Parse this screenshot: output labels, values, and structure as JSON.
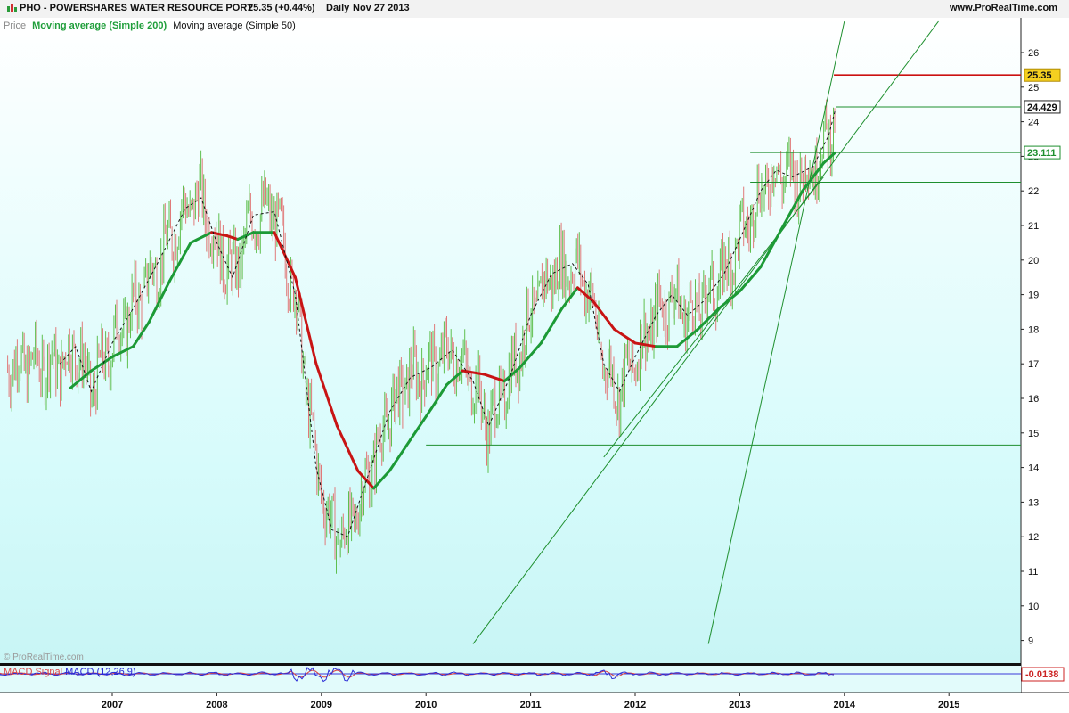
{
  "header": {
    "symbol_label": "PHO - POWERSHARES WATER RESOURCE PORT",
    "quote": "25.35 (+0.44%)",
    "period": "Daily",
    "date": "Nov 27 2013",
    "site": "www.ProRealTime.com"
  },
  "legend": {
    "price": "Price",
    "ma200": "Moving average (Simple 200)",
    "ma50": "Moving average (Simple 50)"
  },
  "watermark": "© ProRealTime.com",
  "macd_legend": {
    "part1": "MACD",
    "part2": " ",
    "part3": "Signal",
    "part4": " MACD (12,26,9)"
  },
  "colors": {
    "plot_bg": "#d6fbfb",
    "candle_up": "#5fbf4f",
    "candle_down": "#e07a7a",
    "ma200_up": "#1c9a36",
    "ma200_down": "#c81414",
    "ma50": "#111111",
    "trend": "#1e8f2e",
    "resistance": "#cc1111",
    "last_price_box": "#f5d020",
    "macd": "#2b2bd6",
    "signal": "#d33"
  },
  "chart_data": {
    "type": "candlestick",
    "y_axis": {
      "range": [
        8.4,
        26.9
      ],
      "ticks": [
        9,
        10,
        11,
        12,
        13,
        14,
        15,
        16,
        17,
        18,
        19,
        20,
        21,
        22,
        23,
        24,
        25,
        26
      ]
    },
    "x_axis": {
      "ticks": [
        "2007",
        "2008",
        "2009",
        "2010",
        "2011",
        "2012",
        "2013",
        "2014",
        "2015"
      ]
    },
    "ma200": [
      {
        "t": 2006.6,
        "v": 16.3
      },
      {
        "t": 2006.8,
        "v": 16.8
      },
      {
        "t": 2007.0,
        "v": 17.2
      },
      {
        "t": 2007.2,
        "v": 17.5
      },
      {
        "t": 2007.35,
        "v": 18.2
      },
      {
        "t": 2007.55,
        "v": 19.4
      },
      {
        "t": 2007.75,
        "v": 20.5
      },
      {
        "t": 2007.95,
        "v": 20.8
      },
      {
        "t": 2008.1,
        "v": 20.7
      },
      {
        "t": 2008.2,
        "v": 20.6
      },
      {
        "t": 2008.35,
        "v": 20.8
      },
      {
        "t": 2008.55,
        "v": 20.8
      },
      {
        "t": 2008.75,
        "v": 19.5
      },
      {
        "t": 2008.95,
        "v": 17.0
      },
      {
        "t": 2009.15,
        "v": 15.2
      },
      {
        "t": 2009.35,
        "v": 13.9
      },
      {
        "t": 2009.5,
        "v": 13.4
      },
      {
        "t": 2009.65,
        "v": 13.9
      },
      {
        "t": 2009.85,
        "v": 14.8
      },
      {
        "t": 2010.05,
        "v": 15.7
      },
      {
        "t": 2010.2,
        "v": 16.4
      },
      {
        "t": 2010.35,
        "v": 16.8
      },
      {
        "t": 2010.55,
        "v": 16.7
      },
      {
        "t": 2010.75,
        "v": 16.5
      },
      {
        "t": 2010.9,
        "v": 16.9
      },
      {
        "t": 2011.1,
        "v": 17.6
      },
      {
        "t": 2011.3,
        "v": 18.6
      },
      {
        "t": 2011.45,
        "v": 19.2
      },
      {
        "t": 2011.6,
        "v": 18.8
      },
      {
        "t": 2011.8,
        "v": 18.0
      },
      {
        "t": 2012.0,
        "v": 17.6
      },
      {
        "t": 2012.2,
        "v": 17.5
      },
      {
        "t": 2012.4,
        "v": 17.5
      },
      {
        "t": 2012.6,
        "v": 18.0
      },
      {
        "t": 2012.8,
        "v": 18.6
      },
      {
        "t": 2013.0,
        "v": 19.1
      },
      {
        "t": 2013.2,
        "v": 19.8
      },
      {
        "t": 2013.4,
        "v": 20.9
      },
      {
        "t": 2013.6,
        "v": 22.0
      },
      {
        "t": 2013.8,
        "v": 22.8
      },
      {
        "t": 2013.91,
        "v": 23.1
      }
    ],
    "ma50": [
      {
        "t": 2006.5,
        "v": 17.0
      },
      {
        "t": 2006.65,
        "v": 17.5
      },
      {
        "t": 2006.8,
        "v": 16.2
      },
      {
        "t": 2007.0,
        "v": 17.6
      },
      {
        "t": 2007.2,
        "v": 18.6
      },
      {
        "t": 2007.45,
        "v": 20.0
      },
      {
        "t": 2007.7,
        "v": 21.5
      },
      {
        "t": 2007.85,
        "v": 21.8
      },
      {
        "t": 2008.0,
        "v": 20.5
      },
      {
        "t": 2008.15,
        "v": 19.5
      },
      {
        "t": 2008.35,
        "v": 21.3
      },
      {
        "t": 2008.55,
        "v": 21.4
      },
      {
        "t": 2008.75,
        "v": 19.0
      },
      {
        "t": 2008.95,
        "v": 14.0
      },
      {
        "t": 2009.1,
        "v": 12.2
      },
      {
        "t": 2009.25,
        "v": 12.0
      },
      {
        "t": 2009.45,
        "v": 13.8
      },
      {
        "t": 2009.65,
        "v": 15.6
      },
      {
        "t": 2009.85,
        "v": 16.6
      },
      {
        "t": 2010.05,
        "v": 16.9
      },
      {
        "t": 2010.25,
        "v": 17.4
      },
      {
        "t": 2010.45,
        "v": 16.5
      },
      {
        "t": 2010.6,
        "v": 15.2
      },
      {
        "t": 2010.8,
        "v": 16.6
      },
      {
        "t": 2011.0,
        "v": 18.4
      },
      {
        "t": 2011.2,
        "v": 19.6
      },
      {
        "t": 2011.4,
        "v": 19.9
      },
      {
        "t": 2011.55,
        "v": 19.3
      },
      {
        "t": 2011.7,
        "v": 17.0
      },
      {
        "t": 2011.85,
        "v": 16.2
      },
      {
        "t": 2012.0,
        "v": 17.2
      },
      {
        "t": 2012.2,
        "v": 18.4
      },
      {
        "t": 2012.35,
        "v": 19.0
      },
      {
        "t": 2012.5,
        "v": 18.4
      },
      {
        "t": 2012.65,
        "v": 18.8
      },
      {
        "t": 2012.85,
        "v": 19.6
      },
      {
        "t": 2013.0,
        "v": 20.6
      },
      {
        "t": 2013.2,
        "v": 22.0
      },
      {
        "t": 2013.35,
        "v": 22.6
      },
      {
        "t": 2013.5,
        "v": 22.4
      },
      {
        "t": 2013.7,
        "v": 22.7
      },
      {
        "t": 2013.85,
        "v": 23.6
      },
      {
        "t": 2013.91,
        "v": 24.3
      }
    ],
    "horizontal_lines": [
      {
        "value": 25.35,
        "from": 2013.9,
        "kind": "resistance"
      },
      {
        "value": 24.429,
        "from": 2013.92,
        "kind": "support"
      },
      {
        "value": 23.111,
        "from": 2013.1,
        "kind": "support"
      },
      {
        "value": 22.25,
        "from": 2013.1,
        "kind": "support"
      },
      {
        "value": 14.65,
        "from": 2010.0,
        "kind": "support"
      }
    ],
    "trendlines": [
      {
        "t1": 2010.45,
        "v1": 8.9,
        "t2": 2014.9,
        "v2": 26.9
      },
      {
        "t1": 2012.7,
        "v1": 8.9,
        "t2": 2014.0,
        "v2": 26.9
      },
      {
        "t1": 2011.7,
        "v1": 14.3,
        "t2": 2013.8,
        "v2": 22.4
      }
    ],
    "price_labels": [
      {
        "value": 25.35,
        "text": "25.35",
        "style": "last"
      },
      {
        "value": 24.429,
        "text": "24.429",
        "style": "plain"
      },
      {
        "value": 23.111,
        "text": "23.111",
        "style": "green"
      }
    ],
    "macd_value": "-0.0138",
    "last_price": 25.35
  }
}
